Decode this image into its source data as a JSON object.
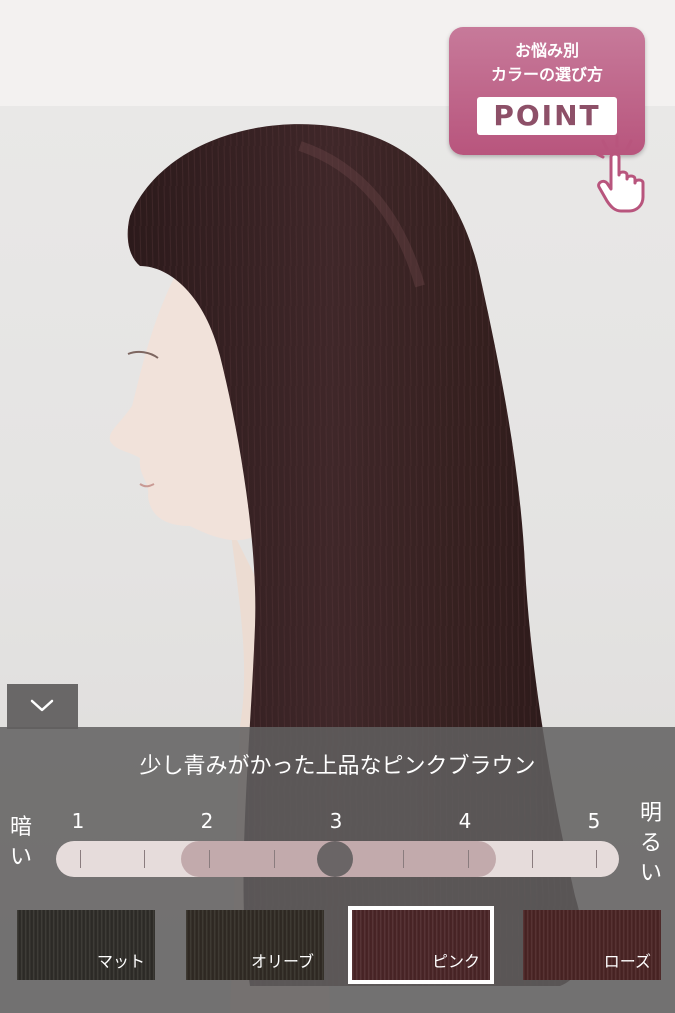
{
  "point_button": {
    "line1": "お悩み別",
    "line2": "カラーの選び方",
    "box": "POINT"
  },
  "colors": {
    "accent_pink": "#b8557d",
    "panel_bg": "#5f5d5d",
    "hair": "#3b2426"
  },
  "panel": {
    "description": "少し青みがかった上品なピンクブラウン",
    "dark_label": "暗い",
    "bright_label": "明るい",
    "scale": [
      "1",
      "2",
      "3",
      "4",
      "5"
    ],
    "selected_level": 3,
    "range_min_level": 2,
    "range_max_level": 4
  },
  "swatches": [
    {
      "label": "マット",
      "color": "#2f2d28",
      "selected": false
    },
    {
      "label": "オリーブ",
      "color": "#302b24",
      "selected": false
    },
    {
      "label": "ピンク",
      "color": "#4a2527",
      "selected": true
    },
    {
      "label": "ローズ",
      "color": "#4a2424",
      "selected": false
    }
  ],
  "icons": {
    "collapse": "chevron-down-icon",
    "tap": "hand-pointer-icon"
  }
}
